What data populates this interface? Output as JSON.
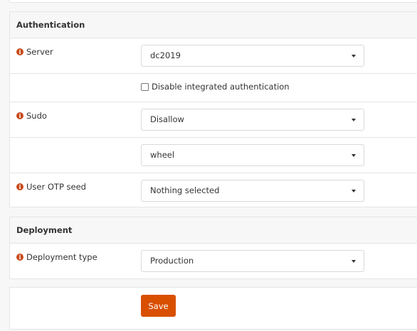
{
  "sections": {
    "authentication": {
      "title": "Authentication",
      "server_label": "Server",
      "server_value": "dc2019",
      "disable_auth_label": "Disable integrated authentication",
      "sudo_label": "Sudo",
      "sudo_value": "Disallow",
      "sudo_group_value": "wheel",
      "otp_label": "User OTP seed",
      "otp_value": "Nothing selected"
    },
    "deployment": {
      "title": "Deployment",
      "type_label": "Deployment type",
      "type_value": "Production"
    }
  },
  "actions": {
    "save_label": "Save"
  },
  "colors": {
    "accent": "#d94f00",
    "info_icon": "#c74a1a"
  },
  "icons": {
    "info": "info-circle-icon",
    "dropdown": "caret-down-icon"
  }
}
